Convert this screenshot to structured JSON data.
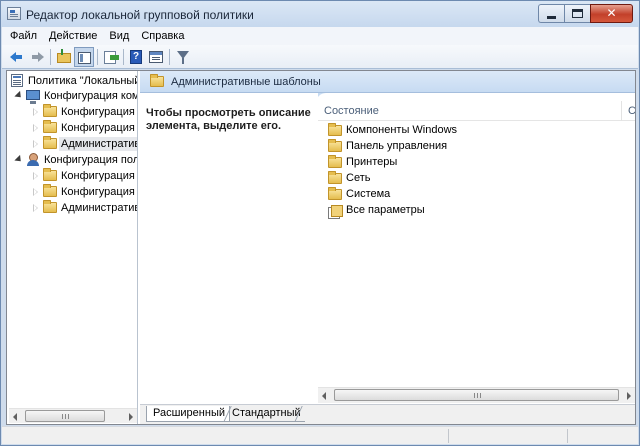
{
  "window": {
    "title": "Редактор локальной групповой политики",
    "close_glyph": "✕"
  },
  "menu": {
    "items": [
      "Файл",
      "Действие",
      "Вид",
      "Справка"
    ]
  },
  "toolbar": {
    "help_glyph": "?"
  },
  "tree": {
    "root": "Политика \"Локальный",
    "nodes": [
      {
        "label": "Конфигурация комп",
        "icon": "computer-icon",
        "level": 1,
        "expanded": true
      },
      {
        "label": "Конфигурация п",
        "icon": "folder-icon",
        "level": 2,
        "expanded": false
      },
      {
        "label": "Конфигурация W",
        "icon": "folder-icon",
        "level": 2,
        "expanded": false
      },
      {
        "label": "Административн",
        "icon": "folder-icon",
        "level": 2,
        "expanded": false,
        "selected": true
      },
      {
        "label": "Конфигурация поль",
        "icon": "user-icon",
        "level": 1,
        "expanded": true
      },
      {
        "label": "Конфигурация п",
        "icon": "folder-icon",
        "level": 2,
        "expanded": false
      },
      {
        "label": "Конфигурация W",
        "icon": "folder-icon",
        "level": 2,
        "expanded": false
      },
      {
        "label": "Административн",
        "icon": "folder-icon",
        "level": 2,
        "expanded": false
      }
    ]
  },
  "details": {
    "header_title": "Административные шаблоны",
    "description": "Чтобы просмотреть описание элемента, выделите его.",
    "columns": [
      "Состояние",
      "С"
    ],
    "items": [
      {
        "label": "Компоненты Windows",
        "icon": "folder-icon"
      },
      {
        "label": "Панель управления",
        "icon": "folder-icon"
      },
      {
        "label": "Принтеры",
        "icon": "folder-icon"
      },
      {
        "label": "Сеть",
        "icon": "folder-icon"
      },
      {
        "label": "Система",
        "icon": "folder-icon"
      },
      {
        "label": "Все параметры",
        "icon": "all-settings-icon"
      }
    ]
  },
  "tabs": {
    "extended": "Расширенный",
    "standard": "Стандартный"
  }
}
